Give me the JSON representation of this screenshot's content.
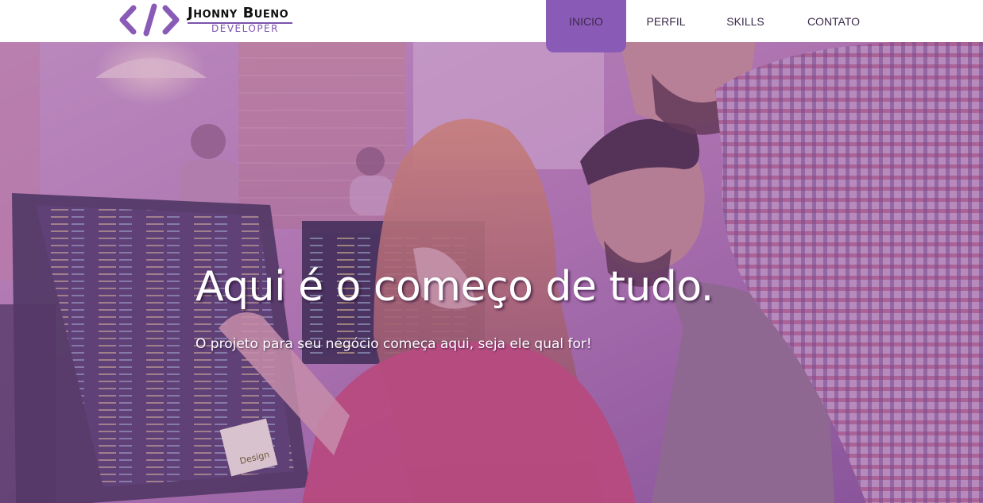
{
  "brand": {
    "logo_icon": "code-brackets-icon",
    "name": "Jhonny Bueno",
    "tagline": "DEVELOPER"
  },
  "nav": {
    "items": [
      {
        "label": "INICIO",
        "active": true
      },
      {
        "label": "PERFIL",
        "active": false
      },
      {
        "label": "SKILLS",
        "active": false
      },
      {
        "label": "CONTATO",
        "active": false
      }
    ]
  },
  "hero": {
    "title": "Aqui é o começo de tudo.",
    "subtitle": "O projeto para seu negócio começa aqui, seja ele qual for!",
    "sticky_note": "Design"
  },
  "colors": {
    "accent": "#8a5bb6",
    "header_bg": "#ffffff",
    "overlay": "#9b5fb0"
  }
}
